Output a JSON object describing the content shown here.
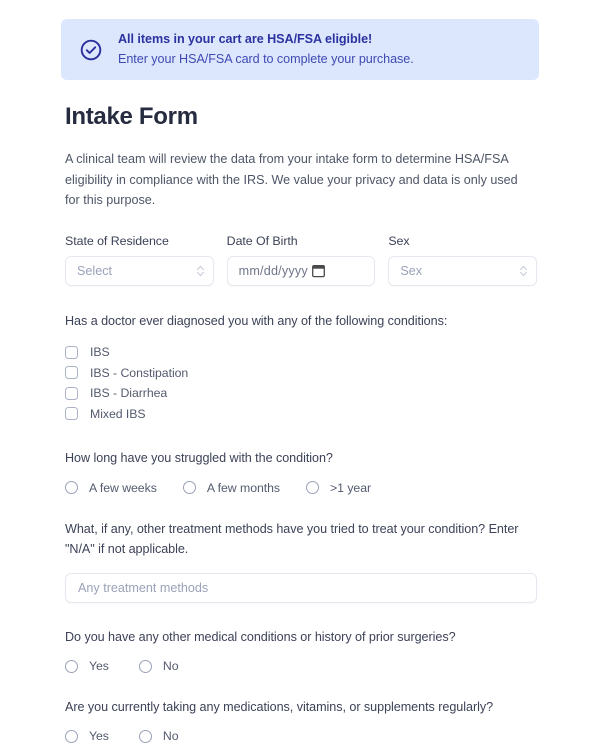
{
  "banner": {
    "icon": "check-circle-icon",
    "title": "All items in your cart are HSA/FSA eligible!",
    "subtitle": "Enter your HSA/FSA card to complete your purchase.",
    "background_color": "#dce7fd",
    "title_color": "#2c32a0"
  },
  "form": {
    "title": "Intake Form",
    "intro": "A clinical team will review the data from your intake form to determine HSA/FSA eligibility in compliance with the IRS. We value your privacy and data is only used for this purpose.",
    "fields": {
      "state": {
        "label": "State of Residence",
        "placeholder": "Select",
        "value": "",
        "icon": "chevron-updown-icon"
      },
      "dob": {
        "label": "Date Of Birth",
        "placeholder": "mm/dd/yyyy",
        "value": "",
        "icon": "calendar-icon"
      },
      "sex": {
        "label": "Sex",
        "placeholder": "Sex",
        "value": "",
        "icon": "chevron-updown-icon"
      }
    },
    "conditions": {
      "question": "Has a doctor ever diagnosed you with any of the following conditions:",
      "options": [
        {
          "label": "IBS",
          "checked": false
        },
        {
          "label": "IBS - Constipation",
          "checked": false
        },
        {
          "label": "IBS - Diarrhea",
          "checked": false
        },
        {
          "label": "Mixed IBS",
          "checked": false
        }
      ]
    },
    "duration": {
      "question": "How long have you struggled with the condition?",
      "options": [
        {
          "label": "A few weeks",
          "selected": false
        },
        {
          "label": "A few months",
          "selected": false
        },
        {
          "label": ">1 year",
          "selected": false
        }
      ]
    },
    "treatments": {
      "question": "What, if any, other treatment methods have you tried to treat your condition? Enter \"N/A\" if not applicable.",
      "placeholder": "Any treatment methods",
      "value": ""
    },
    "other_conditions": {
      "question": "Do you have any other medical conditions or history of prior surgeries?",
      "options": [
        {
          "label": "Yes",
          "selected": false
        },
        {
          "label": "No",
          "selected": false
        }
      ]
    },
    "medications": {
      "question": "Are you currently taking any medications, vitamins, or supplements regularly?",
      "options": [
        {
          "label": "Yes",
          "selected": false
        },
        {
          "label": "No",
          "selected": false
        }
      ]
    }
  }
}
